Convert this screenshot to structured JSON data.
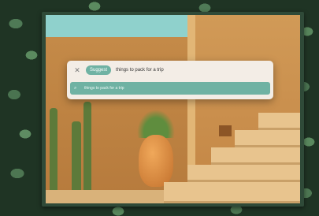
{
  "command_bar": {
    "close_icon": "close-icon",
    "tag_label": "Suggest",
    "query_text": "things to pack for a trip",
    "result_icon": "search-icon",
    "result_text": "things to pack for a trip"
  },
  "colors": {
    "accent": "#6fb2a3",
    "panel": "#f3ede6",
    "frame": "#2f4a38"
  }
}
